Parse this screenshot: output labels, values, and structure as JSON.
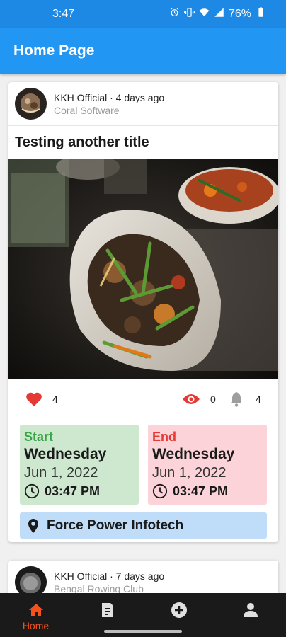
{
  "status_bar": {
    "time": "3:47",
    "battery": "76%"
  },
  "app_bar": {
    "title": "Home Page"
  },
  "posts": [
    {
      "author": "KKH Official",
      "time_ago": "4 days ago",
      "author_line": "KKH Official · 4 days ago",
      "organization": "Coral Software",
      "title": "Testing another title",
      "likes": "4",
      "views": "0",
      "notifications": "4",
      "start": {
        "label": "Start",
        "day": "Wednesday",
        "date": "Jun 1, 2022",
        "time": "03:47 PM"
      },
      "end": {
        "label": "End",
        "day": "Wednesday",
        "date": "Jun 1, 2022",
        "time": "03:47 PM"
      },
      "location": "Force Power Infotech"
    },
    {
      "author": "KKH Official",
      "time_ago": "7 days ago",
      "author_line": "KKH Official · 7 days ago",
      "organization": "Bengal Rowing Club"
    }
  ],
  "bottom_nav": {
    "items": [
      {
        "label": "Home",
        "icon": "home-icon",
        "active": true
      },
      {
        "label": "",
        "icon": "document-icon",
        "active": false
      },
      {
        "label": "",
        "icon": "add-circle-icon",
        "active": false
      },
      {
        "label": "",
        "icon": "person-icon",
        "active": false
      }
    ]
  },
  "colors": {
    "app_bar": "#2196f3",
    "status_bar": "#1e88e5",
    "like": "#e53935",
    "views": "#e53935",
    "start_bg": "#cde8cf",
    "end_bg": "#fbd3d8",
    "location_bg": "#bfdcf8",
    "nav_active": "#f4511e"
  }
}
